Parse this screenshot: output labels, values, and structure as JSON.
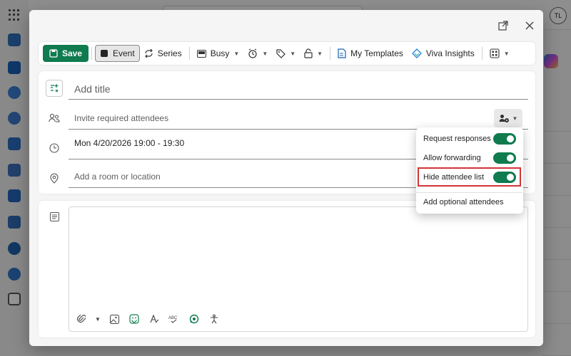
{
  "header": {
    "avatar_initials": "TL"
  },
  "toolbar": {
    "save_label": "Save",
    "event_label": "Event",
    "series_label": "Series",
    "busy_label": "Busy",
    "templates_label": "My Templates",
    "viva_label": "Viva Insights"
  },
  "form": {
    "title_placeholder": "Add title",
    "attendees_placeholder": "Invite required attendees",
    "datetime": "Mon 4/20/2026 19:00 - 19:30",
    "location_placeholder": "Add a room or location"
  },
  "flyout": {
    "items": [
      {
        "label": "Request responses",
        "on": true
      },
      {
        "label": "Allow forwarding",
        "on": true
      },
      {
        "label": "Hide attendee list",
        "on": true
      }
    ],
    "optional_label": "Add optional attendees"
  },
  "colors": {
    "accent": "#0f7b4e",
    "highlight": "#d13438"
  }
}
